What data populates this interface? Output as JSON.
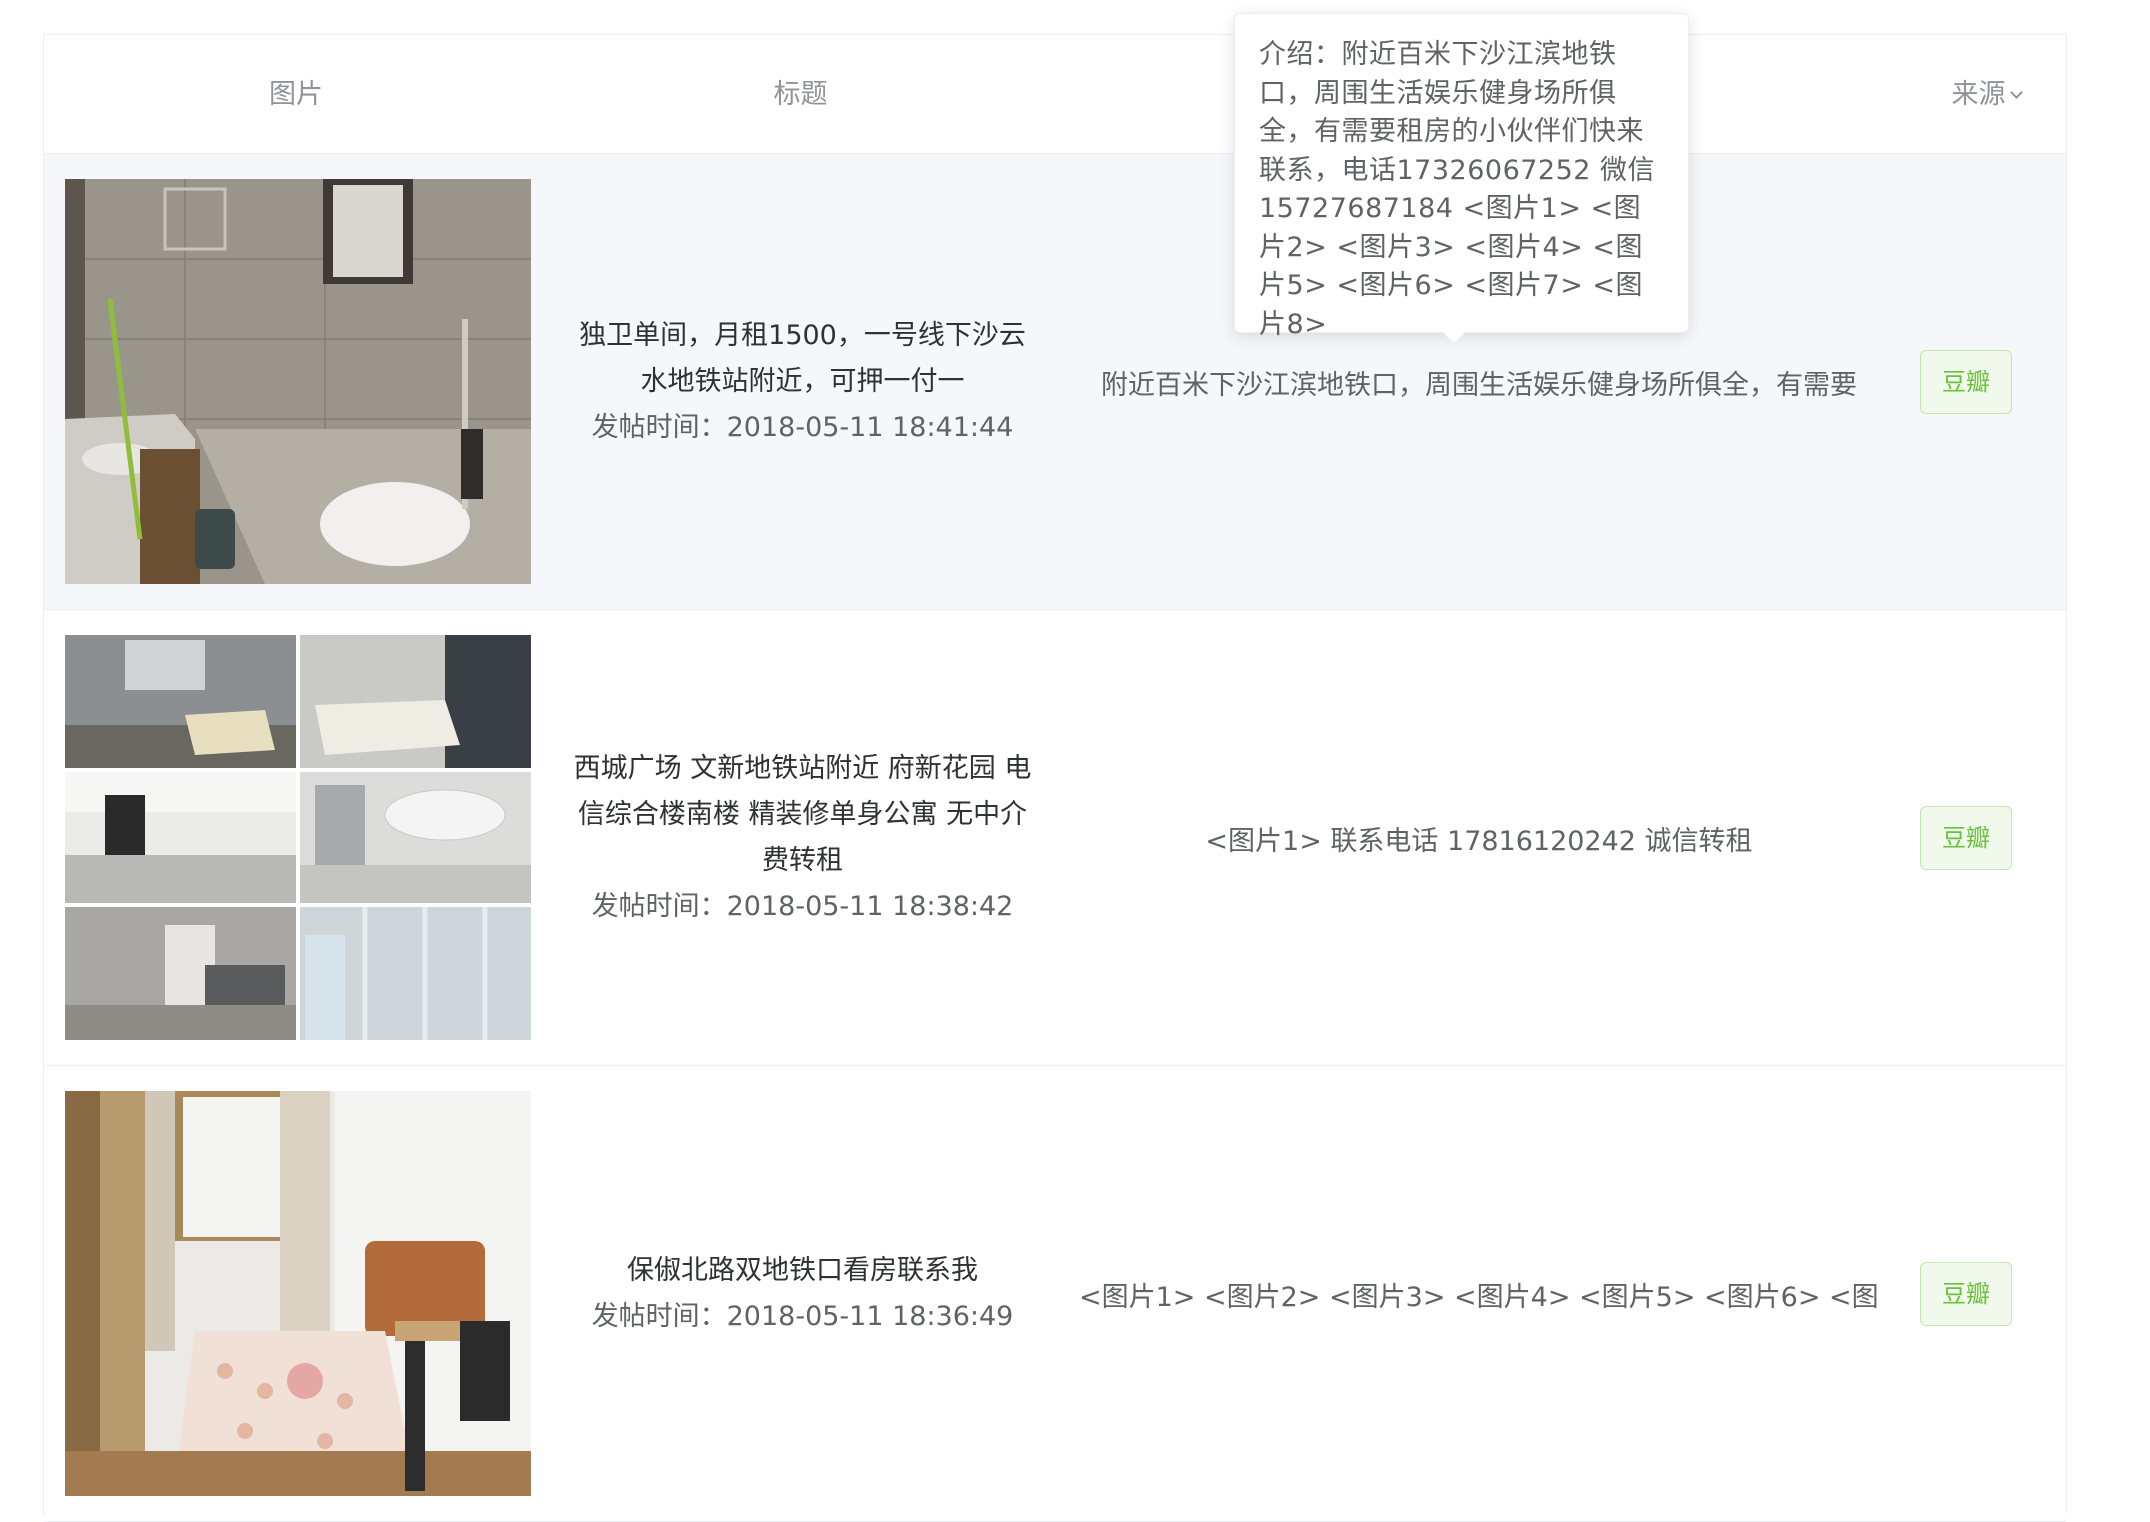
{
  "table": {
    "headers": {
      "image": "图片",
      "title": "标题",
      "source": "来源"
    }
  },
  "tooltip": {
    "text": "介绍：附近百米下沙江滨地铁口，周围生活娱乐健身场所俱全，有需要租房的小伙伴们快来联系，电话17326067252 微信15727687184 <图片1> <图片2> <图片3> <图片4> <图片5> <图片6> <图片7> <图片8>"
  },
  "rows": [
    {
      "title": "独卫单间，月租1500，一号线下沙云水地铁站附近，可押一付一",
      "time": "发帖时间：2018-05-11 18:41:44",
      "desc": "附近百米下沙江滨地铁口，周围生活娱乐健身场所俱全，有需要",
      "source": "豆瓣",
      "image": "bathroom-photo"
    },
    {
      "title": "西城广场 文新地铁站附近 府新花园 电信综合楼南楼 精装修单身公寓 无中介费转租",
      "time": "发帖时间：2018-05-11 18:38:42",
      "desc": "<图片1> 联系电话 17816120242 诚信转租",
      "source": "豆瓣",
      "image": "apartment-collage-photo"
    },
    {
      "title": "保俶北路双地铁口看房联系我",
      "time": "发帖时间：2018-05-11 18:36:49",
      "desc": "<图片1> <图片2> <图片3> <图片4> <图片5> <图片6> <图片",
      "source": "豆瓣",
      "image": "bedroom-photo"
    }
  ]
}
